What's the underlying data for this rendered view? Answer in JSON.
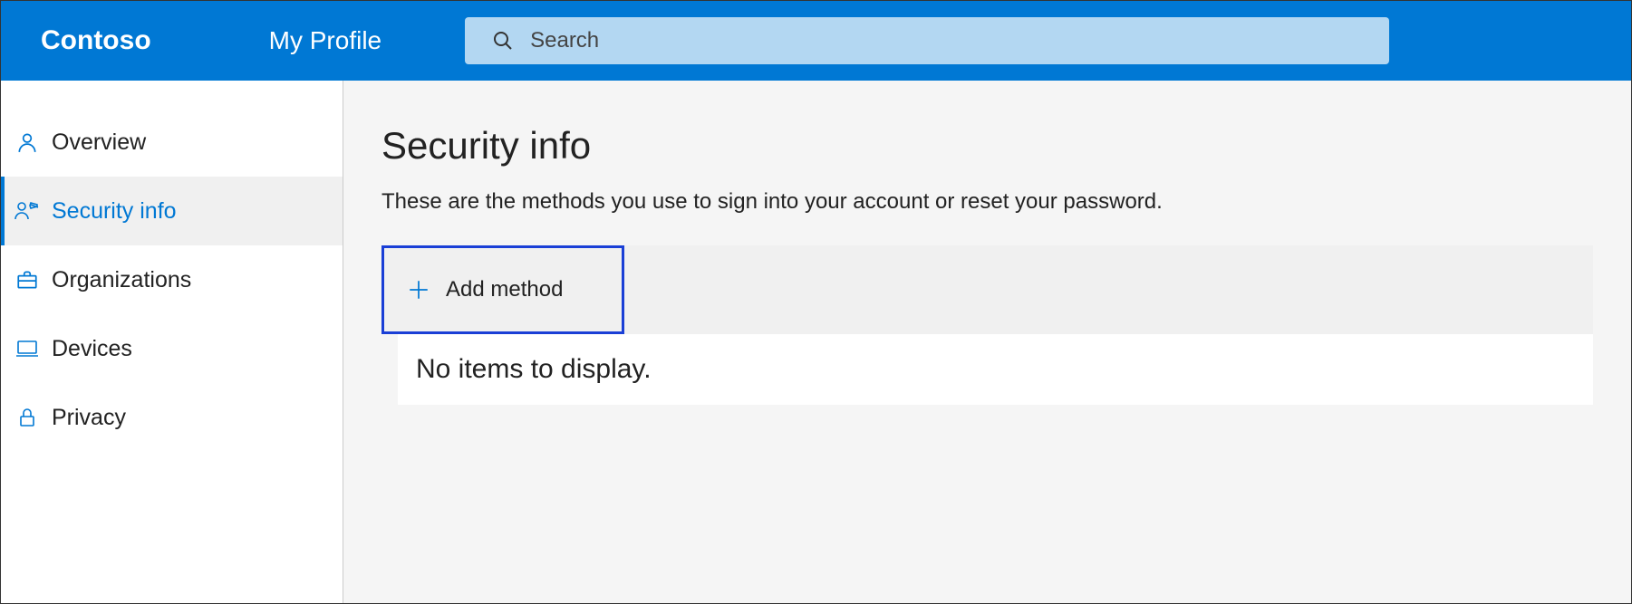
{
  "header": {
    "brand": "Contoso",
    "profile": "My Profile",
    "search_placeholder": "Search"
  },
  "sidebar": {
    "items": [
      {
        "label": "Overview",
        "icon": "person-icon",
        "active": false
      },
      {
        "label": "Security info",
        "icon": "security-info-icon",
        "active": true
      },
      {
        "label": "Organizations",
        "icon": "briefcase-icon",
        "active": false
      },
      {
        "label": "Devices",
        "icon": "device-icon",
        "active": false
      },
      {
        "label": "Privacy",
        "icon": "lock-icon",
        "active": false
      }
    ]
  },
  "main": {
    "title": "Security info",
    "description": "These are the methods you use to sign into your account or reset your password.",
    "add_method_label": "Add method",
    "empty_state": "No items to display."
  },
  "colors": {
    "primary": "#0078d4",
    "highlight_border": "#1a3fd6",
    "search_bg": "#b3d7f2"
  }
}
